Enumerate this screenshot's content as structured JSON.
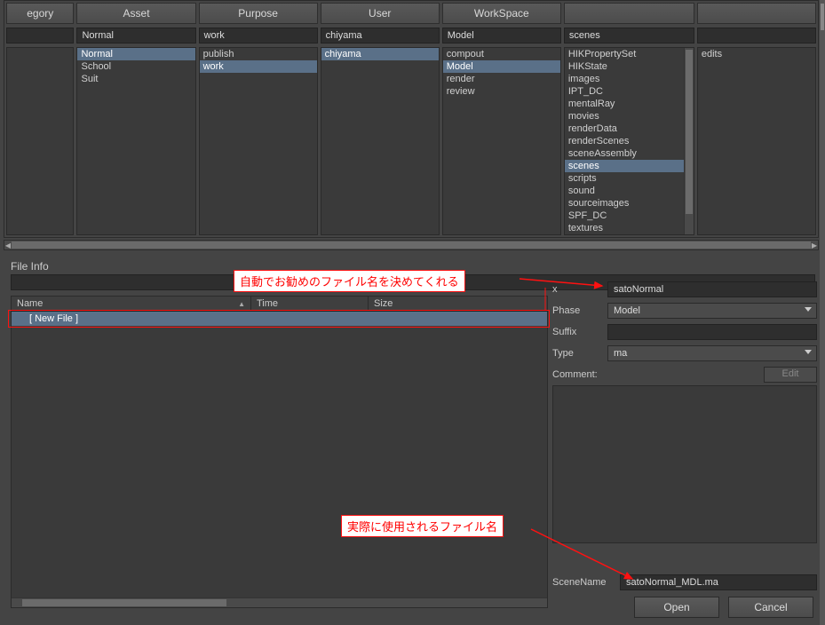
{
  "browser": {
    "columns": [
      {
        "header": "egory",
        "field": "",
        "items": [],
        "selected": null
      },
      {
        "header": "Asset",
        "field": "Normal",
        "items": [
          "Normal",
          "School",
          "Suit"
        ],
        "selected": "Normal"
      },
      {
        "header": "Purpose",
        "field": "work",
        "items": [
          "publish",
          "work"
        ],
        "selected": "work"
      },
      {
        "header": "User",
        "field": "chiyama",
        "items": [
          "chiyama"
        ],
        "selected": "chiyama"
      },
      {
        "header": "WorkSpace",
        "field": "Model",
        "items": [
          "compout",
          "Model",
          "render",
          "review"
        ],
        "selected": "Model"
      },
      {
        "header": "",
        "field": "scenes",
        "items": [
          "HIKPropertySet",
          "HIKState",
          "images",
          "IPT_DC",
          "mentalRay",
          "movies",
          "renderData",
          "renderScenes",
          "sceneAssembly",
          "scenes",
          "scripts",
          "sound",
          "sourceimages",
          "SPF_DC",
          "textures"
        ],
        "selected": "scenes"
      },
      {
        "header": "",
        "field": "",
        "items": [
          "edits"
        ],
        "selected": null
      }
    ]
  },
  "fileinfo": {
    "section_label": "File Info",
    "table": {
      "cols": {
        "name": "Name",
        "time": "Time",
        "size": "Size"
      },
      "rows": [
        {
          "name": "[ New File ]"
        }
      ]
    }
  },
  "form": {
    "prefix_label": "x",
    "prefix_value": "satoNormal",
    "phase_label": "Phase",
    "phase_value": "Model",
    "suffix_label": "Suffix",
    "suffix_value": "",
    "type_label": "Type",
    "type_value": "ma",
    "comment_label": "Comment:",
    "edit_label": "Edit",
    "scenename_label": "SceneName",
    "scenename_value": "satoNormal_MDL.ma",
    "open_label": "Open",
    "cancel_label": "Cancel"
  },
  "annotations": {
    "auto_suggest": "自動でお勧めのファイル名を決めてくれる",
    "actual_name": "実際に使用されるファイル名"
  }
}
